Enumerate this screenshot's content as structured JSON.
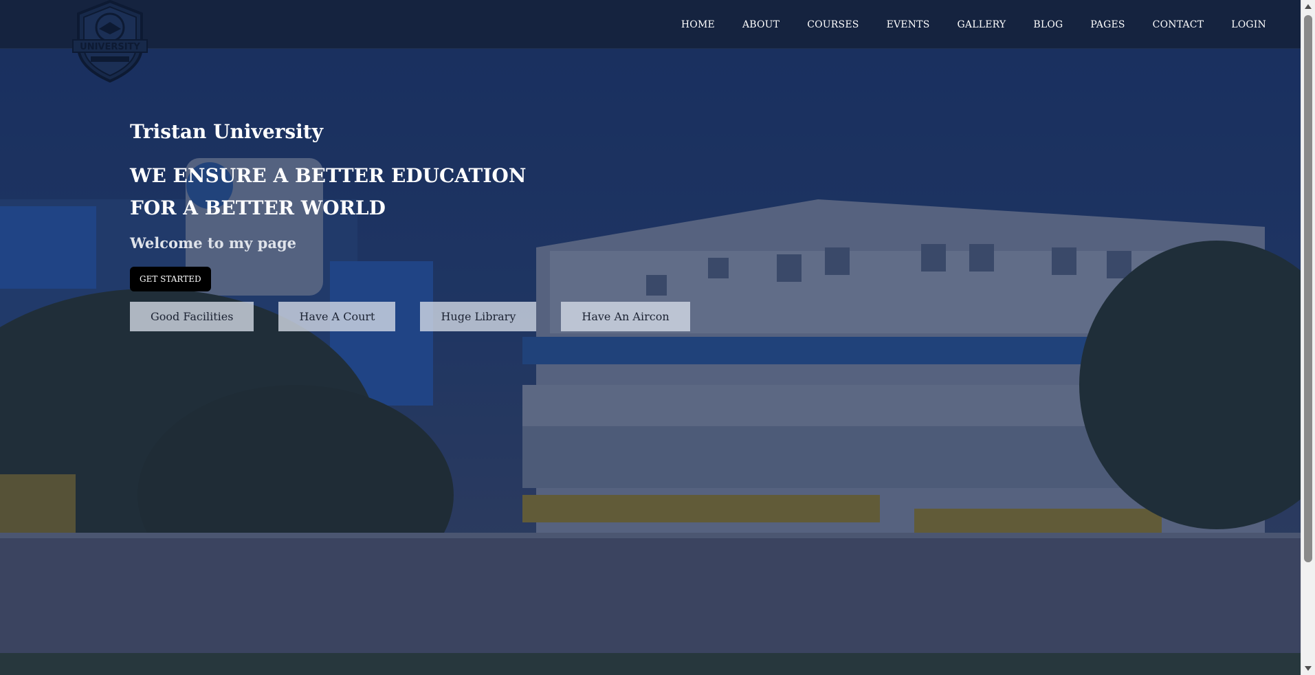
{
  "navbar": {
    "logo_text": "UNIVERSITY",
    "links": [
      "HOME",
      "ABOUT",
      "COURSES",
      "EVENTS",
      "GALLERY",
      "BLOG",
      "PAGES",
      "CONTACT",
      "LOGIN"
    ]
  },
  "hero": {
    "brand": "Tristan University",
    "tagline_line1": "WE ENSURE A BETTER EDUCATION",
    "tagline_line2": "FOR A BETTER WORLD",
    "welcome": "Welcome to my page",
    "cta_label": "GET STARTED",
    "features": [
      "Good Facilities",
      "Have A Court",
      "Huge Library",
      "Have An Aircon"
    ]
  },
  "colors": {
    "navbar_bg": "#15233f",
    "overlay": "#122246",
    "cta_bg": "#000000",
    "feature_bg": "#d6dde8"
  }
}
